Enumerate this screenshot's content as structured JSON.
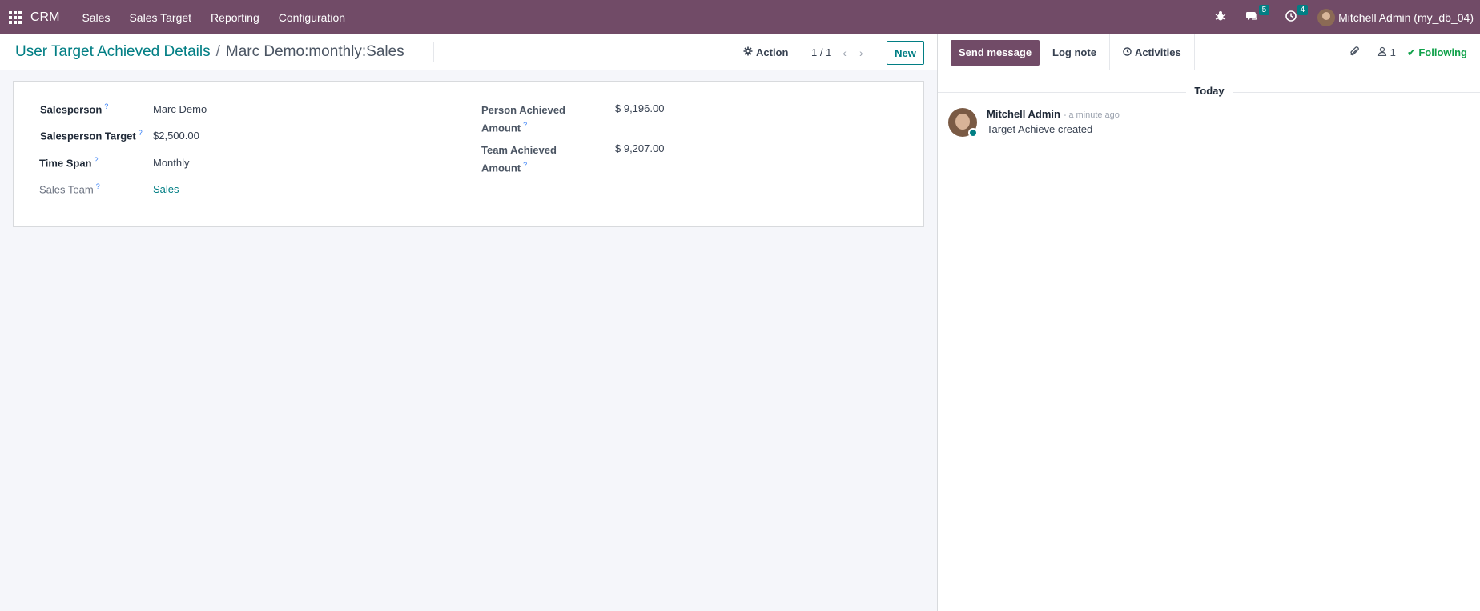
{
  "topbar": {
    "brand": "CRM",
    "menu": [
      "Sales",
      "Sales Target",
      "Reporting",
      "Configuration"
    ],
    "messages_count": "5",
    "activities_count": "4",
    "user_label": "Mitchell Admin (my_db_04)"
  },
  "control": {
    "breadcrumb_parent": "User Target Achieved Details",
    "breadcrumb_sep": "/",
    "breadcrumb_current": "Marc Demo:monthly:Sales",
    "action_label": "Action",
    "pager": "1 / 1",
    "new_label": "New"
  },
  "form": {
    "salesperson_label": "Salesperson",
    "salesperson_value": "Marc Demo",
    "target_label": "Salesperson Target",
    "target_value": "$2,500.00",
    "timespan_label": "Time Span",
    "timespan_value": "Monthly",
    "team_label": "Sales Team",
    "team_value": "Sales",
    "person_achieved_label_1": "Person Achieved",
    "person_achieved_label_2": "Amount",
    "person_achieved_value": "$ 9,196.00",
    "team_achieved_label_1": "Team Achieved",
    "team_achieved_label_2": "Amount",
    "team_achieved_value": "$ 9,207.00",
    "help_mark": "?"
  },
  "chatter": {
    "send_message": "Send message",
    "log_note": "Log note",
    "activities": "Activities",
    "followers": "1",
    "following": "Following",
    "date_divider": "Today",
    "message": {
      "author": "Mitchell Admin",
      "time": "- a minute ago",
      "text": "Target Achieve created"
    }
  },
  "colors": {
    "brand": "#714b67",
    "accent": "#017e84",
    "following": "#10a14a"
  }
}
